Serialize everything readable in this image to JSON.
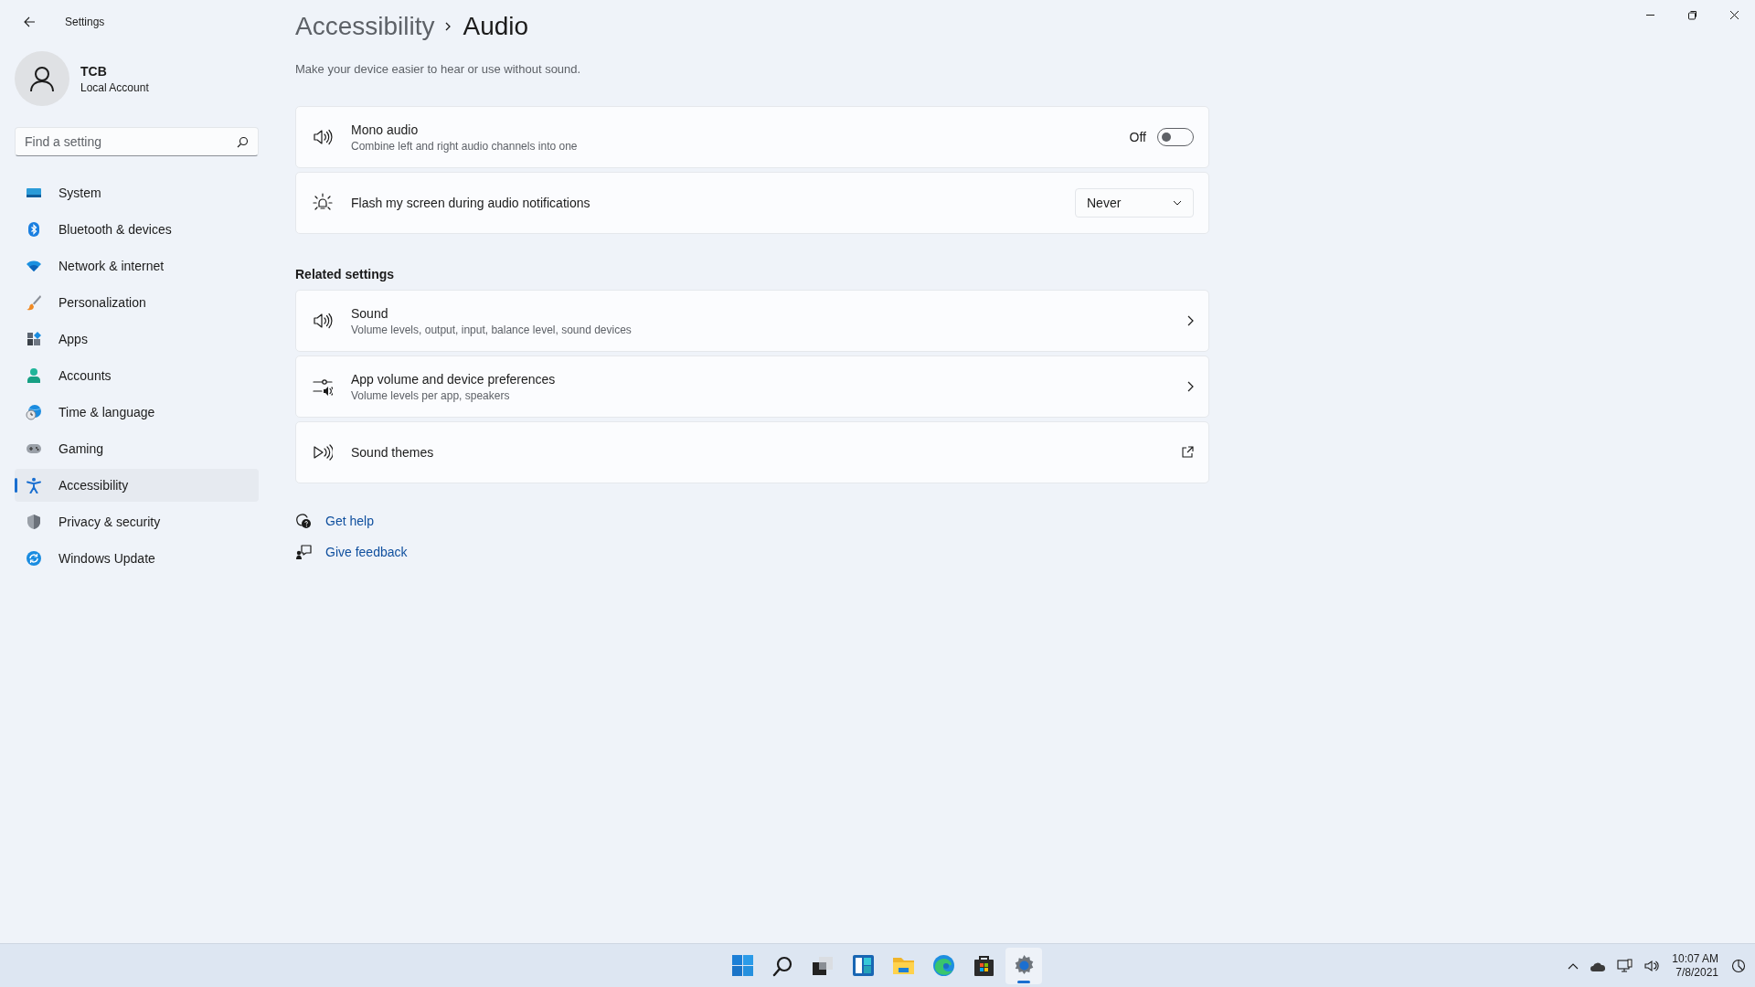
{
  "window": {
    "title": "Settings"
  },
  "user": {
    "name": "TCB",
    "account_type": "Local Account"
  },
  "search": {
    "placeholder": "Find a setting"
  },
  "nav": [
    {
      "label": "System",
      "selected": false
    },
    {
      "label": "Bluetooth & devices",
      "selected": false
    },
    {
      "label": "Network & internet",
      "selected": false
    },
    {
      "label": "Personalization",
      "selected": false
    },
    {
      "label": "Apps",
      "selected": false
    },
    {
      "label": "Accounts",
      "selected": false
    },
    {
      "label": "Time & language",
      "selected": false
    },
    {
      "label": "Gaming",
      "selected": false
    },
    {
      "label": "Accessibility",
      "selected": true
    },
    {
      "label": "Privacy & security",
      "selected": false
    },
    {
      "label": "Windows Update",
      "selected": false
    }
  ],
  "breadcrumb": {
    "parent": "Accessibility",
    "current": "Audio"
  },
  "description": "Make your device easier to hear or use without sound.",
  "settings": [
    {
      "kind": "toggle",
      "title": "Mono audio",
      "subtitle": "Combine left and right audio channels into one",
      "state_label": "Off",
      "on": false
    },
    {
      "kind": "dropdown",
      "title": "Flash my screen during audio notifications",
      "value": "Never"
    }
  ],
  "related": {
    "heading": "Related settings",
    "items": [
      {
        "kind": "chevron",
        "title": "Sound",
        "subtitle": "Volume levels, output, input, balance level, sound devices"
      },
      {
        "kind": "chevron",
        "title": "App volume and device preferences",
        "subtitle": "Volume levels per app, speakers"
      },
      {
        "kind": "external",
        "title": "Sound themes"
      }
    ]
  },
  "help_links": [
    {
      "label": "Get help"
    },
    {
      "label": "Give feedback"
    }
  ],
  "taskbar": {
    "apps": [
      {
        "active": false
      },
      {
        "active": false
      },
      {
        "active": false
      },
      {
        "active": false
      },
      {
        "active": false
      },
      {
        "active": false
      },
      {
        "active": false
      },
      {
        "active": true
      }
    ],
    "clock": {
      "time": "10:07 AM",
      "date": "7/8/2021"
    }
  }
}
